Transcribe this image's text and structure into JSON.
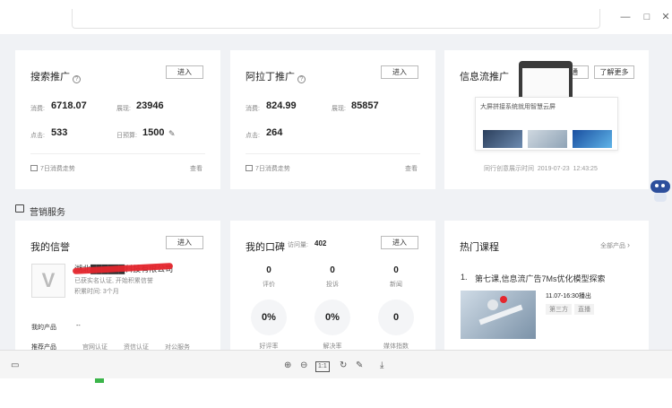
{
  "colors": {
    "page_bg": "#f0f2f5",
    "card_bg": "#ffffff",
    "accent_red": "#e5262d",
    "link_blue": "#3a6fd8"
  },
  "window": {
    "minimize": "—",
    "maximize": "□",
    "close": "✕"
  },
  "search_promo": {
    "title": "搜索推广",
    "enter": "进入",
    "spend_label": "消费:",
    "spend_value": "6718.07",
    "show_label": "展现:",
    "show_value": "23946",
    "click_label": "点击:",
    "click_value": "533",
    "budget_label": "日预算:",
    "budget_value": "1500",
    "trend": "7日消费走势",
    "view": "查看"
  },
  "aladdin_promo": {
    "title": "阿拉丁推广",
    "enter": "进入",
    "spend_label": "消费:",
    "spend_value": "824.99",
    "show_label": "展现:",
    "show_value": "85857",
    "click_label": "点击:",
    "click_value": "264",
    "trend": "7日消费走势",
    "view": "查看"
  },
  "feed_promo": {
    "title": "信息流推广",
    "open": "开通",
    "learn_more": "了解更多",
    "ad_text": "大屏拼接系统就用智慧云屏",
    "caption": "同行创意展示时间  2019-07-23  12:43:25"
  },
  "section": {
    "title": "营销服务"
  },
  "reputation": {
    "title": "我的信誉",
    "enter": "进入",
    "company": "湖北██████科技有限公司",
    "verified": "已获实名认证, 开始积累信誉",
    "time": "积累时间: 3个月",
    "my_products_label": "我的产品",
    "my_products_value": "--",
    "recommend_label": "推荐产品",
    "recommend_items": [
      "官网认证",
      "资信认证",
      "对公服务"
    ]
  },
  "word_of_mouth": {
    "title": "我的口碑",
    "visits_label": "访问量:",
    "visits_value": "402",
    "enter": "进入",
    "stats": [
      {
        "value": "0",
        "label": "评价"
      },
      {
        "value": "0",
        "label": "投诉"
      },
      {
        "value": "0",
        "label": "新闻"
      }
    ],
    "rates": [
      {
        "value": "0%",
        "label": "好评率"
      },
      {
        "value": "0%",
        "label": "解决率"
      },
      {
        "value": "0",
        "label": "媒体指数"
      }
    ]
  },
  "courses": {
    "title": "热门课程",
    "all": "全部产品",
    "item_index": "1.",
    "item_title": "第七课,信息流广告7Ms优化模型探索",
    "time": "11.07-16:30播出",
    "tags": [
      "第三方",
      "直播"
    ]
  }
}
